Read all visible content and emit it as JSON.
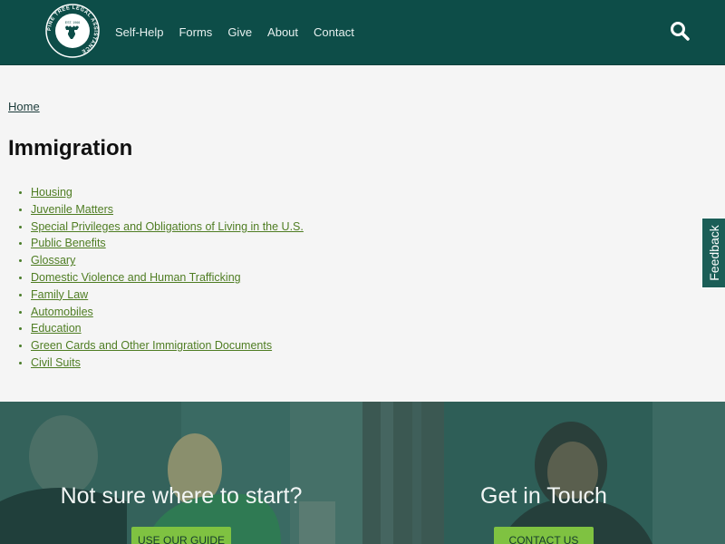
{
  "header": {
    "logo_text_ring": "PINE TREE LEGAL ASSISTANCE",
    "logo_est": "EST. 1966",
    "nav": [
      "Self-Help",
      "Forms",
      "Give",
      "About",
      "Contact"
    ]
  },
  "breadcrumb": {
    "home": "Home"
  },
  "page_title": "Immigration",
  "topics": [
    "Housing",
    "Juvenile Matters",
    "Special Privileges and Obligations of Living in the U.S.",
    "Public Benefits",
    "Glossary",
    "Domestic Violence and Human Trafficking",
    "Family Law",
    "Automobiles",
    "Education",
    "Green Cards and Other Immigration Documents",
    "Civil Suits"
  ],
  "feedback_label": "Feedback",
  "promos": {
    "left": {
      "heading": "Not sure where to start?",
      "button": "USE OUR GUIDE"
    },
    "right": {
      "heading": "Get in Touch",
      "button": "CONTACT US"
    }
  },
  "colors": {
    "header_bg": "#0d4d48",
    "link_green": "#4f7d23",
    "button_green": "#7fc241"
  }
}
